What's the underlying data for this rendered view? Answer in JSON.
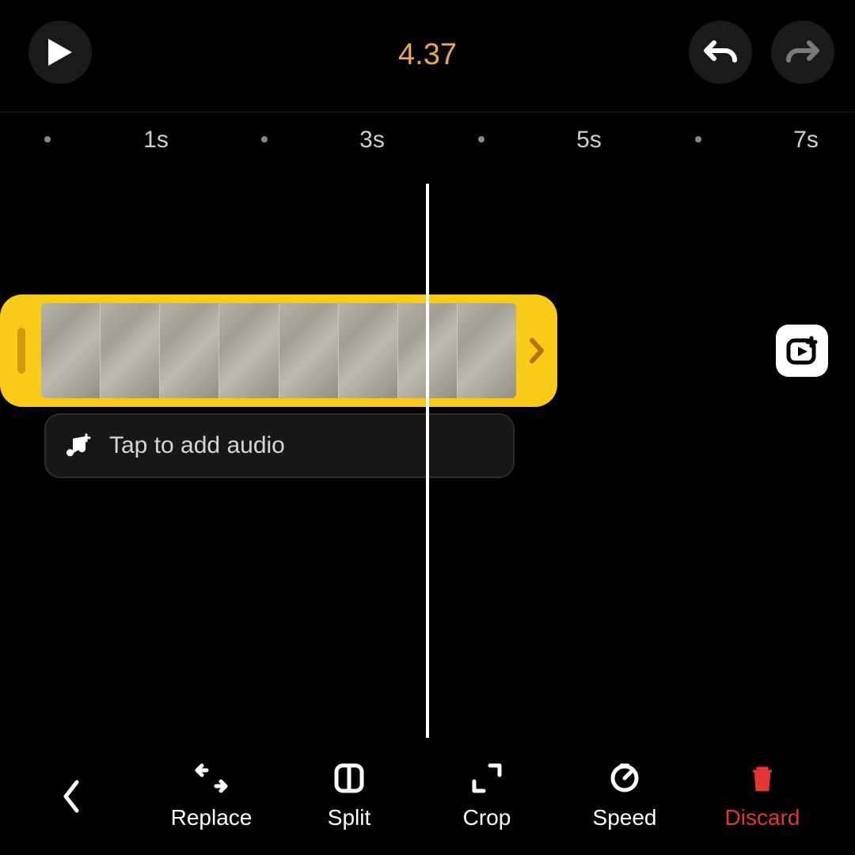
{
  "time": "4.37",
  "ruler": [
    "1s",
    "3s",
    "5s",
    "7s"
  ],
  "audio_prompt": "Tap to add audio",
  "actions": {
    "replace": "Replace",
    "split": "Split",
    "crop": "Crop",
    "speed": "Speed",
    "discard": "Discard"
  },
  "colors": {
    "accent": "#f9cb18",
    "time": "#e9a84e",
    "danger": "#e43434"
  }
}
